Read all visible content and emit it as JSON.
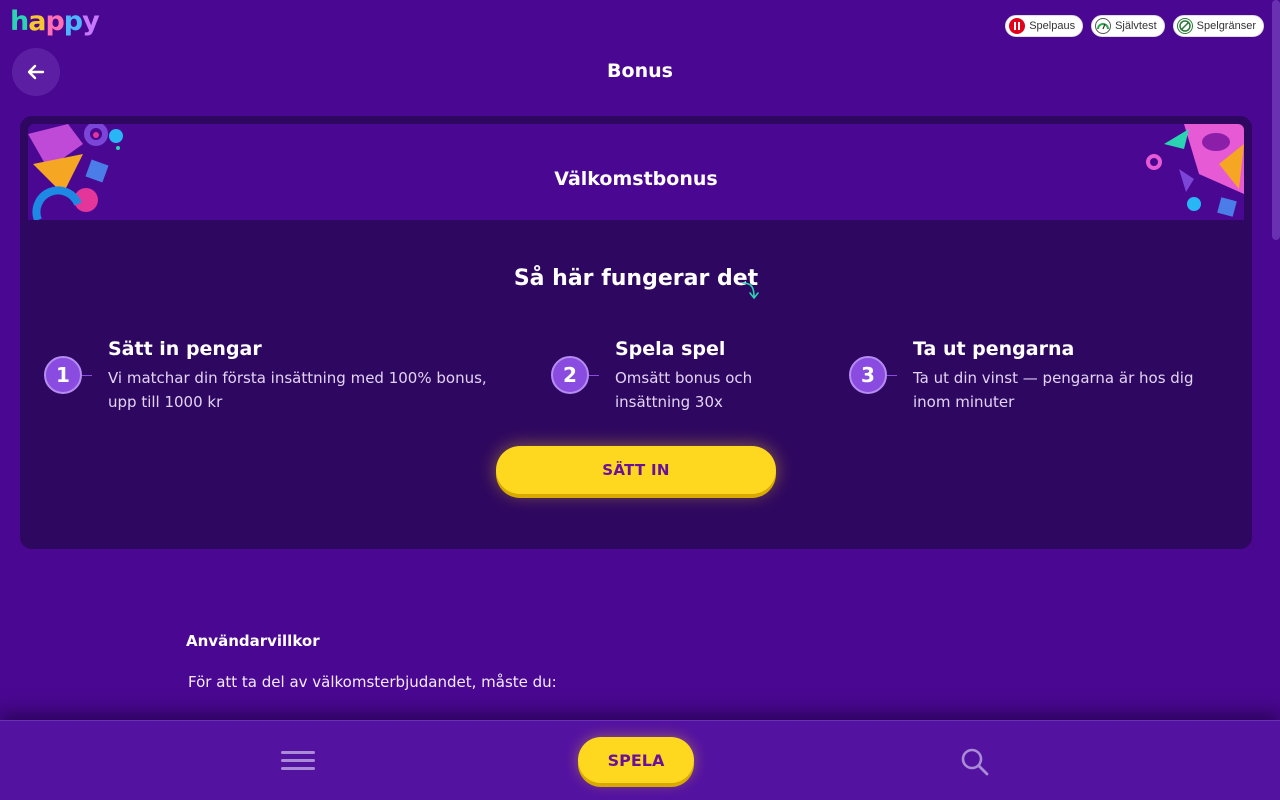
{
  "brand": {
    "logo_letters": [
      "h",
      "a",
      "p",
      "p",
      "y"
    ]
  },
  "responsible_gaming": [
    {
      "label": "Spelpaus",
      "icon": "pause-icon"
    },
    {
      "label": "Självtest",
      "icon": "gauge-icon"
    },
    {
      "label": "Spelgränser",
      "icon": "limit-icon"
    }
  ],
  "header": {
    "title": "Bonus"
  },
  "bonus_card": {
    "banner_title": "Välkomstbonus",
    "how_title": "Så här fungerar det",
    "steps": [
      {
        "number": "1",
        "heading": "Sätt in pengar",
        "text": "Vi matchar din första insättning med 100% bonus, upp till 1000 kr"
      },
      {
        "number": "2",
        "heading": "Spela spel",
        "text": "Omsätt bonus och insättning 30x"
      },
      {
        "number": "3",
        "heading": "Ta ut pengarna",
        "text": "Ta ut din vinst — pengarna är hos dig inom minuter"
      }
    ],
    "deposit_label": "SÄTT IN"
  },
  "terms": {
    "heading": "Användarvillkor",
    "intro": "För att ta del av välkomsterbjudandet, måste du:"
  },
  "bottom_nav": {
    "play_label": "SPELA"
  },
  "colors": {
    "background": "#4a0791",
    "card": "#2e0760",
    "accent": "#fdd81f",
    "step_badge": "#8a4be0"
  }
}
